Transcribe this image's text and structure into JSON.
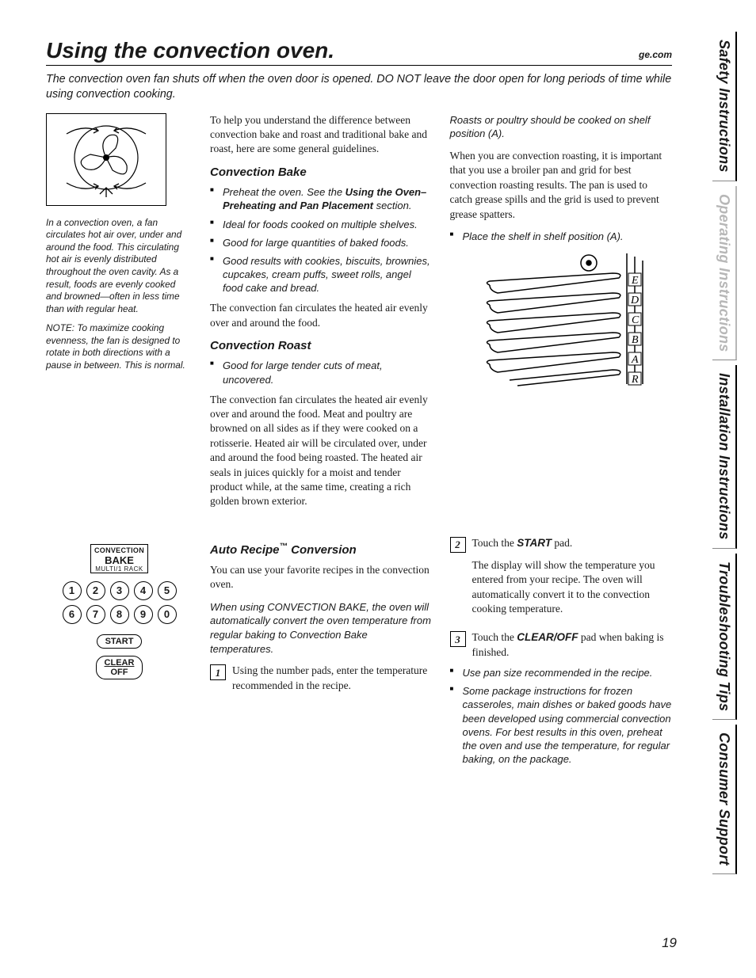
{
  "tabs": [
    "Safety Instructions",
    "Operating Instructions",
    "Installation Instructions",
    "Troubleshooting Tips",
    "Consumer Support"
  ],
  "heading": "Using the convection oven.",
  "url": "ge.com",
  "intro": "The convection oven fan shuts off when the oven door is opened. DO NOT leave the door open for long periods of time while using convection cooking.",
  "sidebar": {
    "p1": "In a convection oven, a fan circulates hot air over, under and around the food. This circulating hot air is evenly distributed throughout the oven cavity. As a result, foods are evenly cooked and browned—often in less time than with regular heat.",
    "p2": "NOTE: To maximize cooking evenness, the fan is designed to rotate in both directions with a pause in between. This is normal."
  },
  "sec1": {
    "p1": "To help you understand the difference between convection bake and roast and traditional bake and roast, here are some general guidelines.",
    "h_bake": "Convection Bake",
    "bake_b1a": "Preheat the oven. See the ",
    "bake_b1b": "Using the Oven– Preheating and Pan Placement",
    "bake_b1c": " section.",
    "bake_b2": "Ideal for foods cooked on multiple shelves.",
    "bake_b3": "Good for large quantities of baked foods.",
    "bake_b4": "Good results with cookies, biscuits, brownies, cupcakes, cream puffs, sweet rolls, angel food cake and bread.",
    "p2": "The convection fan circulates the heated air evenly over and around the food.",
    "h_roast": "Convection Roast",
    "roast_b1": "Good for large tender cuts of meat, uncovered.",
    "p3": "The convection fan circulates the heated air evenly over and around the food. Meat and poultry are browned on all sides as if they were cooked on a rotisserie. Heated air will be circulated over, under and around the food being roasted. The heated air seals in juices quickly for a moist and tender product while, at the same time, creating a rich golden brown exterior.",
    "p4": "Roasts or poultry should be cooked on shelf position (A).",
    "p5": "When you are convection roasting, it is important that you use a broiler pan and grid for best convection roasting results. The pan is used to catch grease spills and the grid is used to prevent grease spatters.",
    "p6": "Place the shelf in shelf position (A)."
  },
  "sec2": {
    "btn_line1": "CONVECTION",
    "btn_line2": "BAKE",
    "btn_line3": "MULTI/1 RACK",
    "start": "START",
    "clear1": "CLEAR",
    "clear2": "OFF",
    "heading": "Auto Recipe™ Conversion",
    "p1": "You can use your favorite recipes in the convection oven.",
    "p2": "When using CONVECTION BAKE, the oven will automatically convert the oven temperature from regular baking to Convection Bake temperatures.",
    "step1": "Using the number pads, enter the temperature recommended in the recipe.",
    "step2a": "Touch the ",
    "step2b": "START",
    "step2c": " pad.",
    "step2p": "The display will show the temperature you entered from your recipe. The oven will automatically convert it to the convection cooking temperature.",
    "step3a": "Touch the ",
    "step3b": "CLEAR/OFF",
    "step3c": " pad when baking is finished.",
    "b1": "Use pan size recommended in the recipe.",
    "b2": "Some package instructions for frozen casseroles, main dishes or baked goods have been developed using commercial convection ovens. For best results in this oven, preheat the oven and use the temperature, for regular baking, on the package."
  },
  "page_num": "19",
  "shelf_labels": [
    "E",
    "D",
    "C",
    "B",
    "A",
    "R"
  ]
}
